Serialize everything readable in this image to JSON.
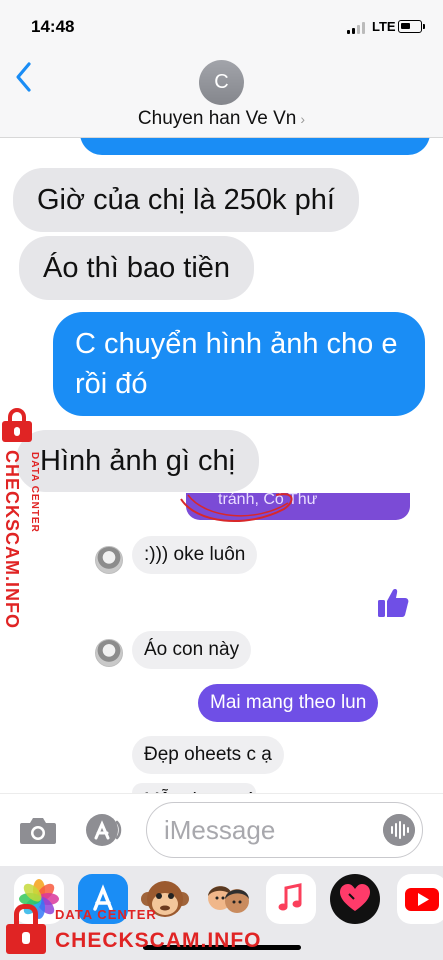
{
  "status_bar": {
    "time": "14:48",
    "network": "LTE"
  },
  "header": {
    "avatar_initial": "C",
    "contact_name": "Chuyen han Ve Vn",
    "chevron": "›"
  },
  "messages": [
    {
      "side": "received",
      "text": "Giờ của chị là 250k phí"
    },
    {
      "side": "received",
      "text": "Áo thì bao tiền"
    },
    {
      "side": "sent",
      "text": "C chuyển hình ảnh cho e rồi đó"
    },
    {
      "side": "received",
      "text": "Hình ảnh gì chị"
    }
  ],
  "embedded_screenshot": {
    "partial_header_text": "tránh, Có Thư",
    "messages": [
      {
        "side": "received",
        "text": ":))) oke luôn"
      },
      {
        "side": "sent",
        "icon": "thumbs-up-icon"
      },
      {
        "side": "received",
        "text": "Áo con này"
      },
      {
        "side": "sent",
        "text": "Mai mang theo lun"
      },
      {
        "side": "received",
        "text": "Đẹp oheets c ạ"
      },
      {
        "side": "received",
        "text": "Mẫu đẹp quá"
      }
    ]
  },
  "input_bar": {
    "placeholder": "iMessage"
  },
  "app_strip": [
    "photos",
    "app-store",
    "animoji",
    "memoji",
    "music",
    "digital-touch",
    "youtube"
  ],
  "watermark": {
    "brand": "CHECKSCAM.INFO",
    "tagline": "DATA CENTER"
  },
  "colors": {
    "imessage_blue": "#1a8df5",
    "messenger_purple": "#6f4fe6",
    "watermark_red": "#e02424"
  }
}
